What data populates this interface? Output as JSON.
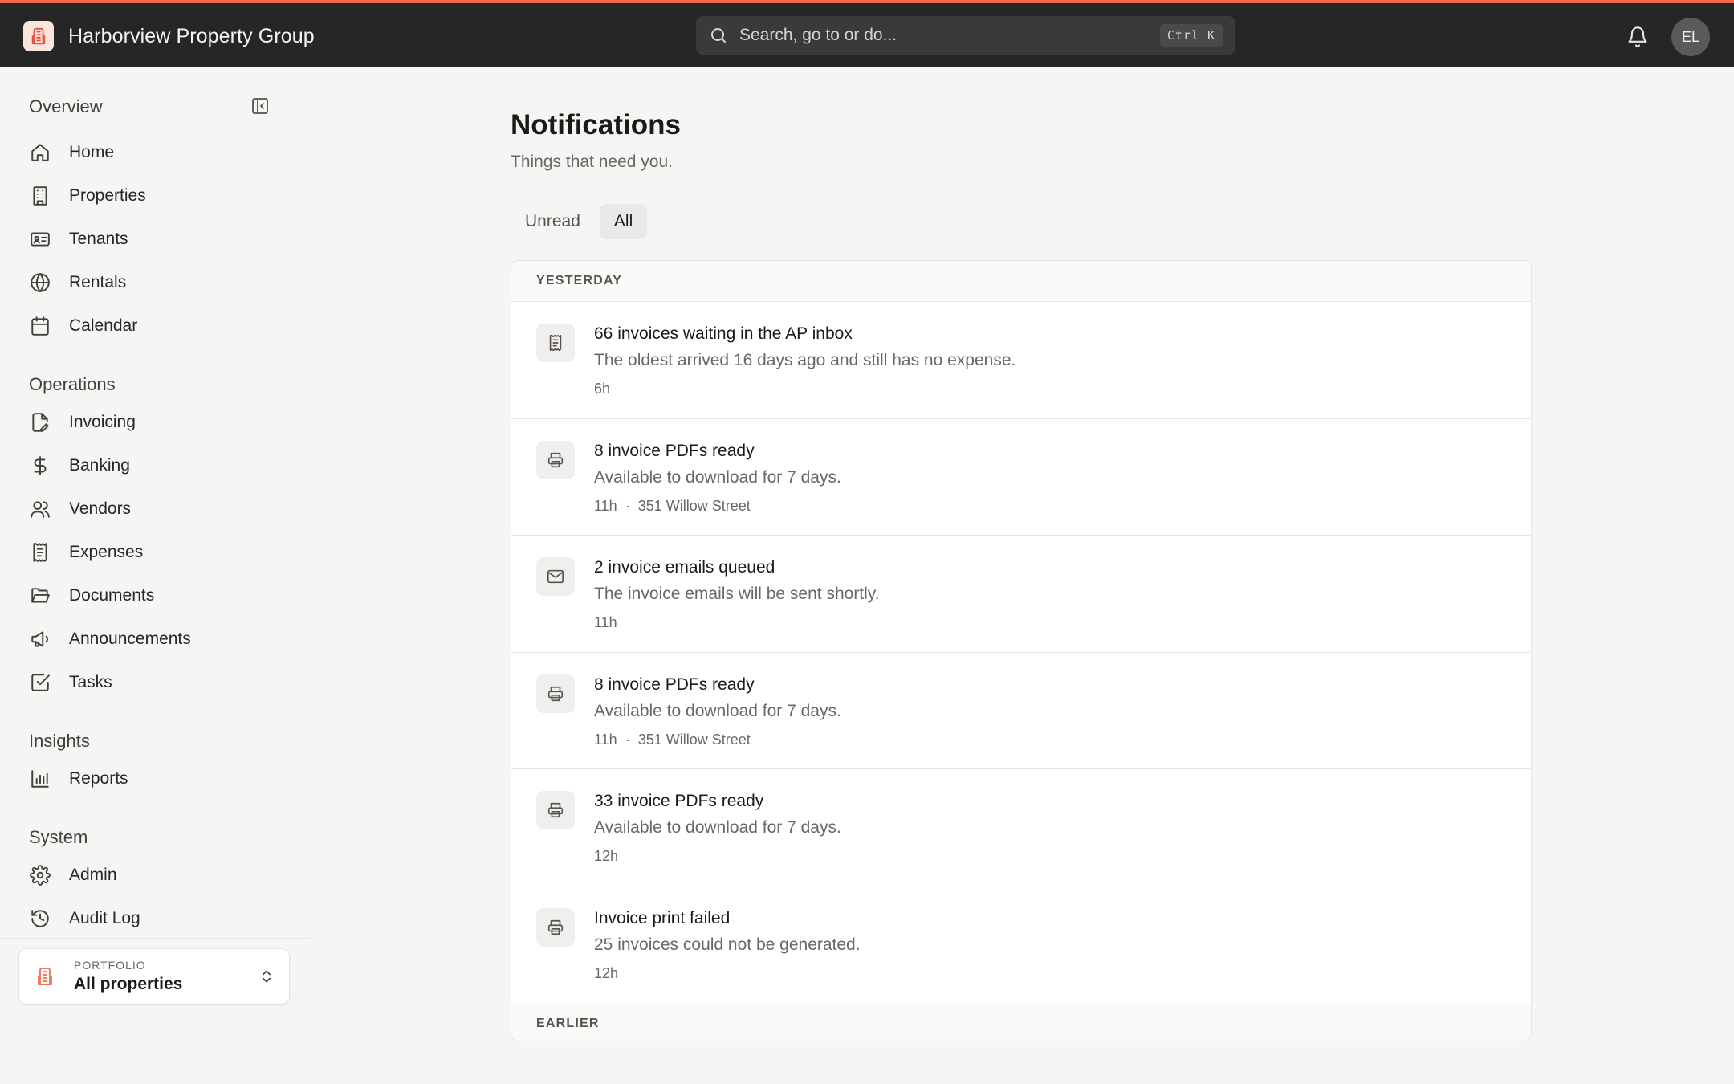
{
  "app": {
    "name": "Harborview Property Group",
    "accent": "#f26b4f"
  },
  "search": {
    "placeholder": "Search, go to or do...",
    "shortcut": "Ctrl K"
  },
  "user": {
    "initials": "EL"
  },
  "sidebar": {
    "sections": [
      {
        "title": "Overview",
        "items": [
          {
            "label": "Home",
            "icon": "home-icon"
          },
          {
            "label": "Properties",
            "icon": "building-icon"
          },
          {
            "label": "Tenants",
            "icon": "id-card-icon"
          },
          {
            "label": "Rentals",
            "icon": "globe-icon"
          },
          {
            "label": "Calendar",
            "icon": "calendar-icon"
          }
        ]
      },
      {
        "title": "Operations",
        "items": [
          {
            "label": "Invoicing",
            "icon": "file-pen-icon"
          },
          {
            "label": "Banking",
            "icon": "dollar-icon"
          },
          {
            "label": "Vendors",
            "icon": "users-icon"
          },
          {
            "label": "Expenses",
            "icon": "receipt-icon"
          },
          {
            "label": "Documents",
            "icon": "folder-open-icon"
          },
          {
            "label": "Announcements",
            "icon": "megaphone-icon"
          },
          {
            "label": "Tasks",
            "icon": "checkbox-icon"
          }
        ]
      },
      {
        "title": "Insights",
        "items": [
          {
            "label": "Reports",
            "icon": "bar-chart-icon"
          }
        ]
      },
      {
        "title": "System",
        "items": [
          {
            "label": "Admin",
            "icon": "gear-icon"
          },
          {
            "label": "Audit Log",
            "icon": "history-icon"
          }
        ]
      }
    ],
    "portfolio": {
      "label": "PORTFOLIO",
      "value": "All properties"
    }
  },
  "page": {
    "title": "Notifications",
    "subtitle": "Things that need you.",
    "tabs": [
      {
        "label": "Unread",
        "active": false
      },
      {
        "label": "All",
        "active": true
      }
    ]
  },
  "notifications": {
    "groups": [
      {
        "label": "YESTERDAY"
      },
      {
        "label": "EARLIER"
      }
    ],
    "items": [
      {
        "icon": "receipt-icon",
        "title": "66 invoices waiting in the AP inbox",
        "body": "The oldest arrived 16 days ago and still has no expense.",
        "time": "6h",
        "location": ""
      },
      {
        "icon": "printer-icon",
        "title": "8 invoice PDFs ready",
        "body": "Available to download for 7 days.",
        "time": "11h",
        "location": "351 Willow Street"
      },
      {
        "icon": "mail-icon",
        "title": "2 invoice emails queued",
        "body": "The invoice emails will be sent shortly.",
        "time": "11h",
        "location": ""
      },
      {
        "icon": "printer-icon",
        "title": "8 invoice PDFs ready",
        "body": "Available to download for 7 days.",
        "time": "11h",
        "location": "351 Willow Street"
      },
      {
        "icon": "printer-icon",
        "title": "33 invoice PDFs ready",
        "body": "Available to download for 7 days.",
        "time": "12h",
        "location": ""
      },
      {
        "icon": "printer-icon",
        "title": "Invoice print failed",
        "body": "25 invoices could not be generated.",
        "time": "12h",
        "location": ""
      }
    ]
  }
}
